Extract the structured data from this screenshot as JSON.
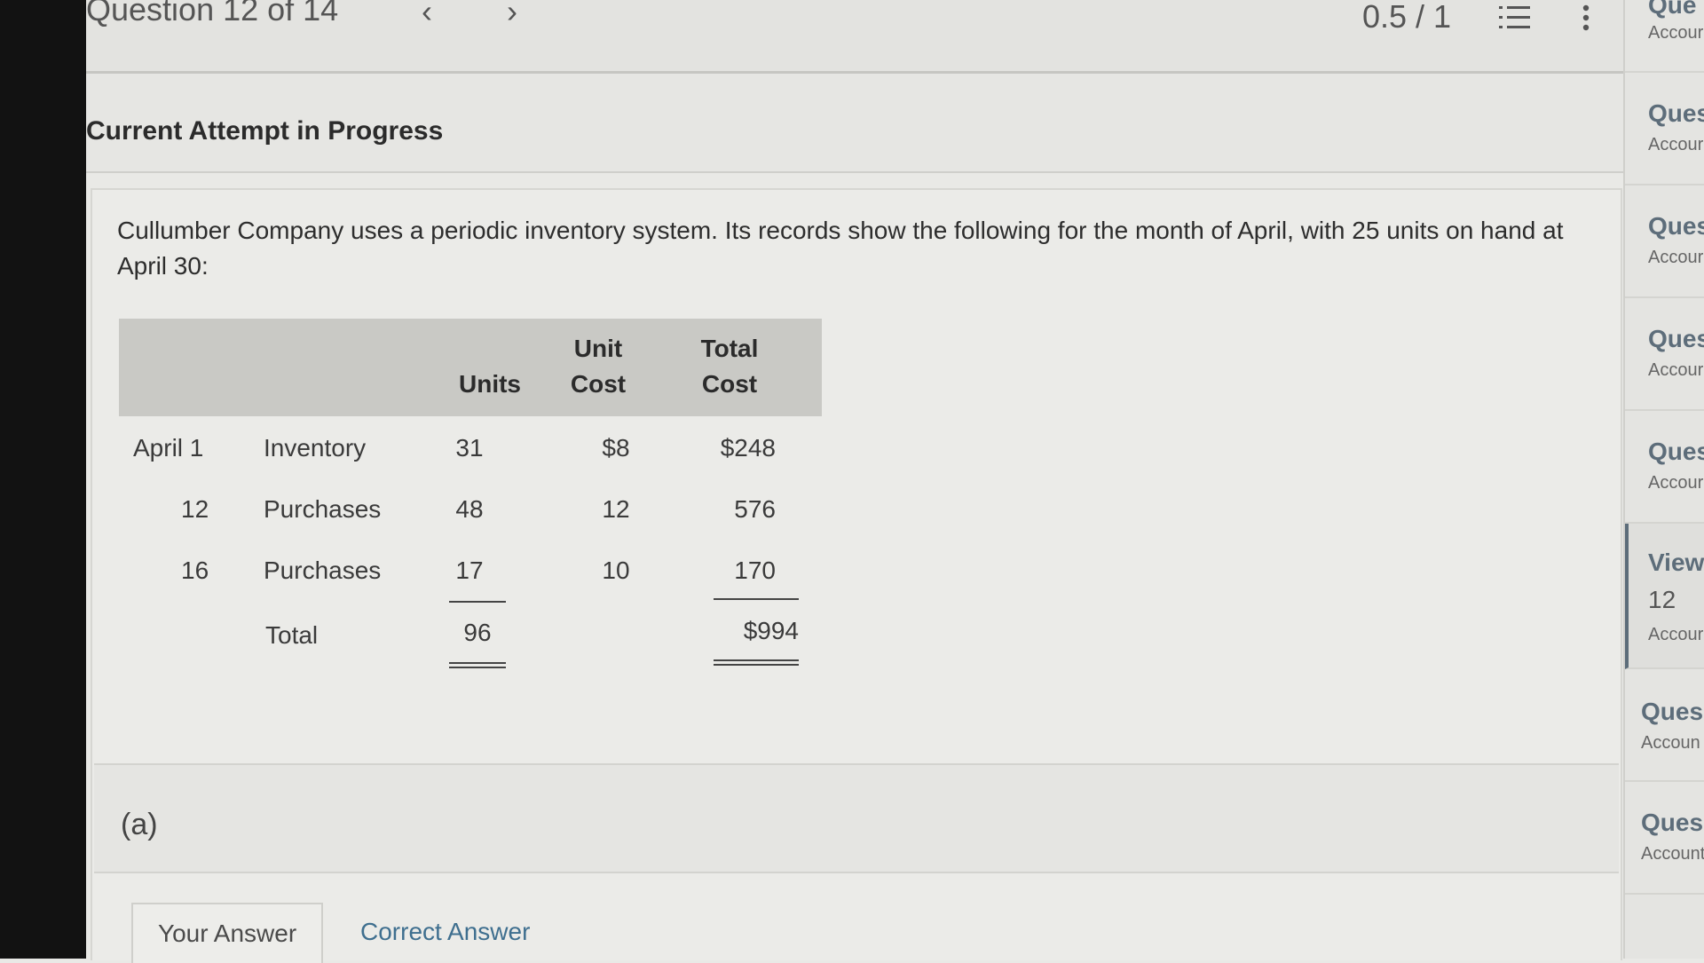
{
  "header": {
    "question_counter": "Question 12 of 14",
    "prev_icon": "‹",
    "next_icon": "›",
    "score": "0.5 / 1",
    "list_icon": "list-icon",
    "more_icon": "more-vertical-icon"
  },
  "attempt": {
    "title": "Current Attempt in Progress"
  },
  "question": {
    "text": "Cullumber Company uses a periodic inventory system. Its records show the following for the month of April, with 25 units on hand at April 30:"
  },
  "table": {
    "headers": {
      "units": "Units",
      "unit_cost_1": "Unit",
      "unit_cost_2": "Cost",
      "total_cost_1": "Total",
      "total_cost_2": "Cost"
    },
    "rows": [
      {
        "date": "April 1",
        "desc": "Inventory",
        "units": "31",
        "unit_cost": "$8",
        "total_cost": "$248"
      },
      {
        "date": "12",
        "desc": "Purchases",
        "units": "48",
        "unit_cost": "12",
        "total_cost": "576"
      },
      {
        "date": "16",
        "desc": "Purchases",
        "units": "17",
        "unit_cost": "10",
        "total_cost": "170"
      }
    ],
    "total": {
      "label": "Total",
      "units": "96",
      "total_cost": "$994"
    }
  },
  "part": {
    "label": "(a)"
  },
  "tabs": {
    "your_answer": "Your Answer",
    "correct_answer": "Correct Answer"
  },
  "sidebar": {
    "items": [
      {
        "title": "Que",
        "sub": "Accour"
      },
      {
        "title": "Ques",
        "sub": "Accour"
      },
      {
        "title": "Ques",
        "sub": "Accour"
      },
      {
        "title": "Ques",
        "sub": "Accour"
      },
      {
        "title": "Ques",
        "sub": "Accour"
      },
      {
        "title": "View",
        "number": "12",
        "sub": "Accour"
      },
      {
        "title": "Ques",
        "sub": "Accoun"
      },
      {
        "title": "Ques",
        "sub": "Account"
      }
    ]
  }
}
